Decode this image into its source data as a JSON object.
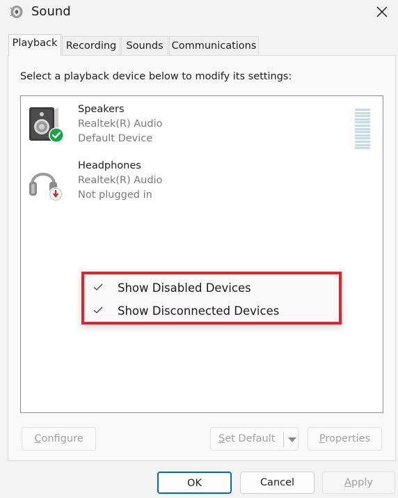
{
  "window": {
    "title": "Sound",
    "icons": {
      "app": "speaker-app-icon",
      "close": "close-icon"
    }
  },
  "tabs": [
    {
      "label": "Playback",
      "active": true
    },
    {
      "label": "Recording",
      "active": false
    },
    {
      "label": "Sounds",
      "active": false
    },
    {
      "label": "Communications",
      "active": false
    }
  ],
  "panel": {
    "instructions": "Select a playback device below to modify its settings:"
  },
  "devices": [
    {
      "name": "Speakers",
      "driver": "Realtek(R) Audio",
      "status": "Default Device",
      "icon": "speaker-icon",
      "badge": "default-check-icon"
    },
    {
      "name": "Headphones",
      "driver": "Realtek(R) Audio",
      "status": "Not plugged in",
      "icon": "headphones-icon",
      "badge": "unplugged-arrow-icon"
    }
  ],
  "context_menu": {
    "items": [
      {
        "label": "Show Disabled Devices",
        "checked": true
      },
      {
        "label": "Show Disconnected Devices",
        "checked": true
      }
    ]
  },
  "panel_buttons": {
    "configure": {
      "access": "C",
      "rest": "onfigure",
      "enabled": false
    },
    "set_default": {
      "access": "S",
      "rest": "et Default",
      "enabled": false
    },
    "properties": {
      "access": "P",
      "rest": "roperties",
      "enabled": false
    }
  },
  "dialog_buttons": {
    "ok": "OK",
    "cancel": "Cancel",
    "apply": "Apply",
    "apply_access": "A",
    "apply_rest": "pply"
  },
  "colors": {
    "accent": "#0067c0",
    "highlight_border": "#e0242d",
    "default_badge": "#16a34a",
    "unplugged_badge": "#d92626",
    "disabled_text": "#a0a0a0"
  }
}
